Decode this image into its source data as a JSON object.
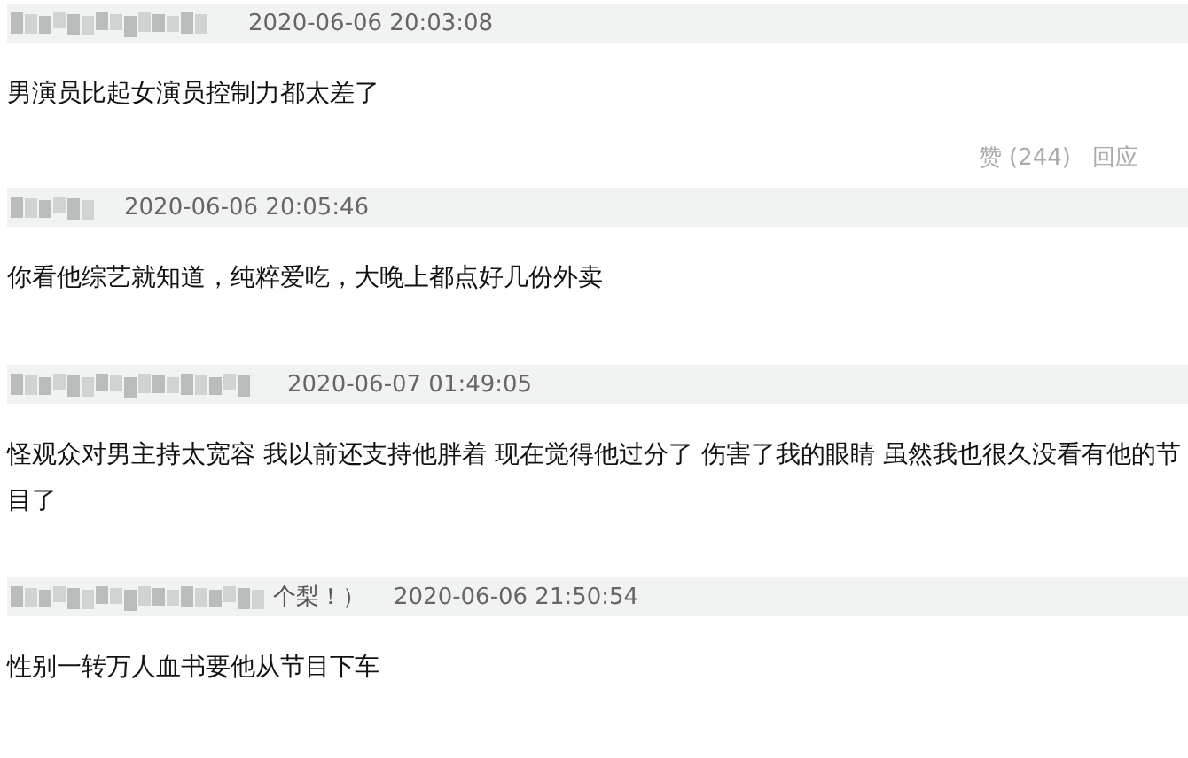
{
  "comments": [
    {
      "time": "2020-06-06 20:03:08",
      "text": "男演员比起女演员控制力都太差了",
      "actions": [
        {
          "label": "赞 (244)"
        },
        {
          "label": "回应"
        }
      ]
    },
    {
      "time": "2020-06-06 20:05:46",
      "text": "你看他综艺就知道，纯粹爱吃，大晚上都点好几份外卖"
    },
    {
      "time": "2020-06-07 01:49:05",
      "text": "怪观众对男主持太宽容 我以前还支持他胖着 现在觉得他过分了 伤害了我的眼睛 虽然我也很久没看有他的节目了"
    },
    {
      "user_visible": "个梨！）",
      "time": "2020-06-06 21:50:54",
      "text": "性别一转万人血书要他从节目下车"
    }
  ]
}
